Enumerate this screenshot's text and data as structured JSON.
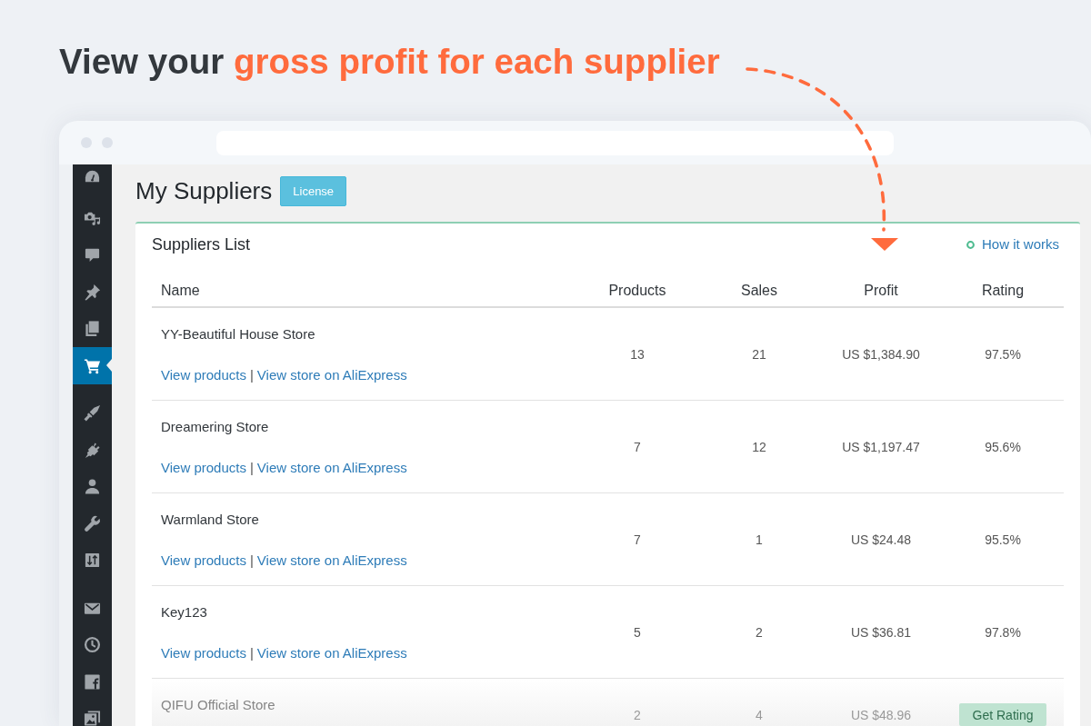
{
  "headline": {
    "lead": "View your",
    "highlight": "gross profit for each supplier"
  },
  "sidebar": {
    "groups": [
      {
        "items": [
          {
            "selected": false
          }
        ]
      },
      {
        "items": [
          {
            "selected": false
          },
          {
            "selected": false
          },
          {
            "selected": false
          },
          {
            "selected": false
          },
          {
            "selected": true
          }
        ]
      },
      {
        "items": [
          {
            "selected": false
          },
          {
            "selected": false
          },
          {
            "selected": false
          },
          {
            "selected": false
          },
          {
            "selected": false
          }
        ]
      },
      {
        "items": [
          {
            "selected": false
          },
          {
            "selected": false
          },
          {
            "selected": false
          },
          {
            "selected": false
          }
        ]
      }
    ]
  },
  "page": {
    "title": "My Suppliers",
    "license_button": "License"
  },
  "card": {
    "title": "Suppliers List",
    "help_link": "How it works",
    "columns": [
      "Name",
      "Products",
      "Sales",
      "Profit",
      "Rating"
    ],
    "rows": [
      {
        "name": "YY-Beautiful House Store",
        "links": [
          "View products",
          "View store on AliExpress"
        ],
        "separator": "|",
        "products": "13",
        "sales": "21",
        "profit": "US $1,384.90",
        "rating": "97.5%",
        "faded": false
      },
      {
        "name": "Dreamering Store",
        "links": [
          "View products",
          "View store on AliExpress"
        ],
        "separator": "|",
        "products": "7",
        "sales": "12",
        "profit": "US $1,197.47",
        "rating": "95.6%",
        "faded": false
      },
      {
        "name": "Warmland Store",
        "links": [
          "View products",
          "View store on AliExpress"
        ],
        "separator": "|",
        "products": "7",
        "sales": "1",
        "profit": "US $24.48",
        "rating": "95.5%",
        "faded": false
      },
      {
        "name": "Key123",
        "links": [
          "View products",
          "View store on AliExpress"
        ],
        "separator": "|",
        "products": "5",
        "sales": "2",
        "profit": "US $36.81",
        "rating": "97.8%",
        "faded": false
      },
      {
        "name": "QIFU Official Store",
        "products": "2",
        "sales": "4",
        "profit": "US $48.96",
        "rating_button": "Get Rating",
        "faded": true
      }
    ]
  }
}
